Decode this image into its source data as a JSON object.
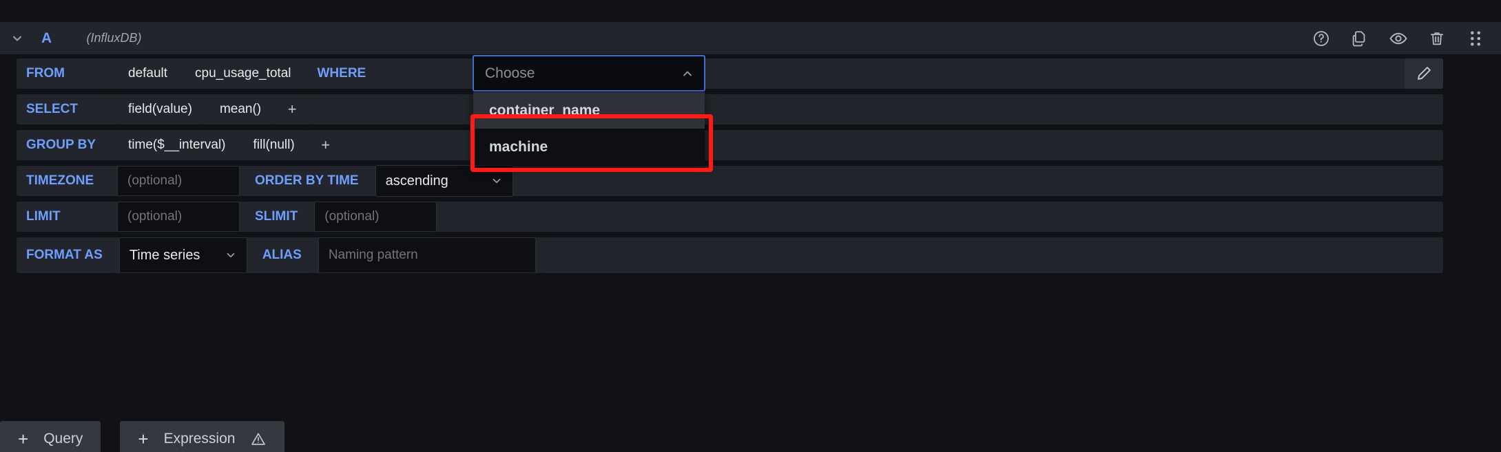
{
  "header": {
    "collapse_icon": "chevron-down-icon",
    "ref_id": "A",
    "datasource": "(InfluxDB)",
    "actions": [
      {
        "name": "help-icon",
        "label": "?"
      },
      {
        "name": "duplicate-icon",
        "label": ""
      },
      {
        "name": "eye-icon",
        "label": ""
      },
      {
        "name": "trash-icon",
        "label": ""
      },
      {
        "name": "drag-handle-icon",
        "label": ""
      }
    ]
  },
  "rows": {
    "from": {
      "label": "FROM",
      "policy": "default",
      "measurement": "cpu_usage_total",
      "where_label": "WHERE",
      "edit_icon": "pencil-icon"
    },
    "select": {
      "label": "SELECT",
      "field": "field(value)",
      "aggregation": "mean()",
      "add": "+"
    },
    "group_by": {
      "label": "GROUP BY",
      "time": "time($__interval)",
      "fill": "fill(null)",
      "add": "+"
    },
    "timezone": {
      "label": "TIMEZONE",
      "placeholder": "(optional)",
      "value": "",
      "order_label": "ORDER BY TIME",
      "order_value": "ascending"
    },
    "limit": {
      "label": "LIMIT",
      "placeholder": "(optional)",
      "value": "",
      "slimit_label": "SLIMIT",
      "slimit_placeholder": "(optional)",
      "slimit_value": ""
    },
    "format": {
      "label": "FORMAT AS",
      "value": "Time series",
      "alias_label": "ALIAS",
      "alias_placeholder": "Naming pattern",
      "alias_value": ""
    }
  },
  "dropdown": {
    "placeholder": "Choose",
    "caret_icon": "chevron-up-icon",
    "options": [
      {
        "label": "container_name",
        "highlighted": true
      },
      {
        "label": "machine",
        "highlighted": false
      }
    ]
  },
  "annotation": {
    "type": "rectangle",
    "color": "#ff1a14",
    "targets": "container_name"
  },
  "footer": {
    "query_button": "Query",
    "expression_button": "Expression",
    "plus": "+",
    "warning_icon": "warning-triangle-icon"
  },
  "colors": {
    "background": "#111217",
    "row": "#22252b",
    "input": "#0e0f13",
    "keyword": "#6e9fff",
    "focus_border": "#3d71d9",
    "annotation": "#ff1a14",
    "text": "#e7e9ed",
    "muted": "#8b9098"
  }
}
